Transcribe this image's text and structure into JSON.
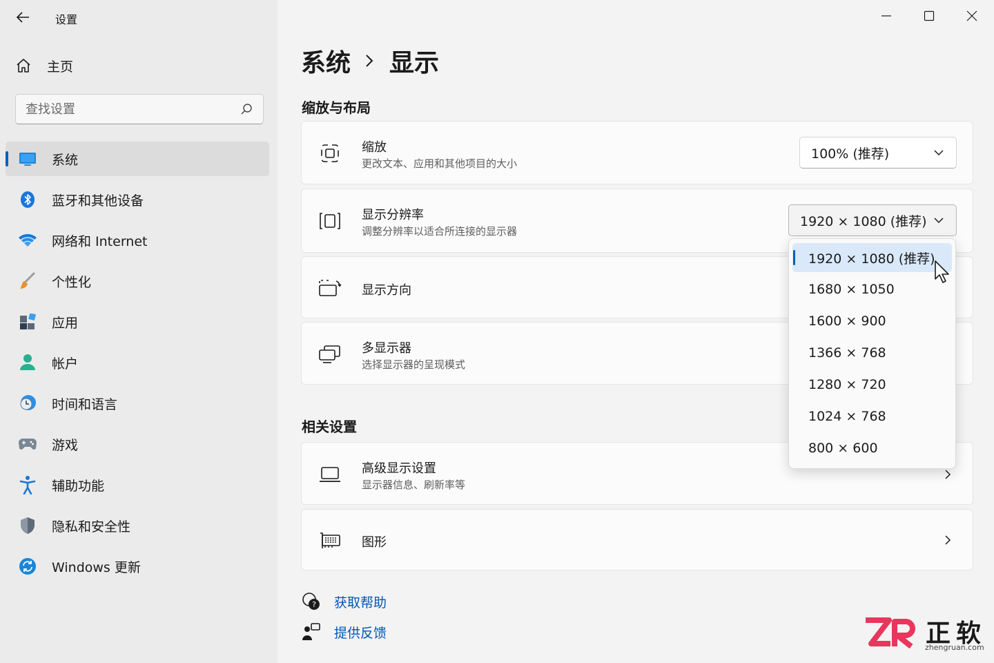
{
  "app": {
    "title": "设置"
  },
  "sidebar": {
    "home_label": "主页",
    "search_placeholder": "查找设置",
    "items": [
      {
        "label": "系统",
        "icon": "system-monitor-icon",
        "active": true
      },
      {
        "label": "蓝牙和其他设备",
        "icon": "bluetooth-icon"
      },
      {
        "label": "网络和 Internet",
        "icon": "wifi-icon"
      },
      {
        "label": "个性化",
        "icon": "paintbrush-icon"
      },
      {
        "label": "应用",
        "icon": "apps-icon"
      },
      {
        "label": "帐户",
        "icon": "account-icon"
      },
      {
        "label": "时间和语言",
        "icon": "time-language-icon"
      },
      {
        "label": "游戏",
        "icon": "gamepad-icon"
      },
      {
        "label": "辅助功能",
        "icon": "accessibility-icon"
      },
      {
        "label": "隐私和安全性",
        "icon": "shield-icon"
      },
      {
        "label": "Windows 更新",
        "icon": "windows-update-icon"
      }
    ]
  },
  "header": {
    "breadcrumb_parent": "系统",
    "breadcrumb_current": "显示"
  },
  "sections": {
    "scale_layout": "缩放与布局",
    "related": "相关设置"
  },
  "cards": {
    "scale": {
      "title": "缩放",
      "subtitle": "更改文本、应用和其他项目的大小",
      "value": "100% (推荐)"
    },
    "resolution": {
      "title": "显示分辨率",
      "subtitle": "调整分辨率以适合所连接的显示器",
      "value": "1920 × 1080 (推荐)"
    },
    "orientation": {
      "title": "显示方向"
    },
    "multi_display": {
      "title": "多显示器",
      "subtitle": "选择显示器的呈现模式"
    },
    "advanced": {
      "title": "高级显示设置",
      "subtitle": "显示器信息、刷新率等"
    },
    "graphics": {
      "title": "图形"
    }
  },
  "resolution_options": [
    "1920 × 1080 (推荐)",
    "1680 × 1050",
    "1600 × 900",
    "1366 × 768",
    "1280 × 720",
    "1024 × 768",
    "800 × 600"
  ],
  "links": {
    "help": "获取帮助",
    "feedback": "提供反馈"
  },
  "watermark": {
    "logo": "ZR",
    "name": "正软",
    "domain": "zhengruan.com"
  },
  "colors": {
    "accent": "#005fb8",
    "link": "#0057b3",
    "watermark_red": "#e8365d"
  }
}
